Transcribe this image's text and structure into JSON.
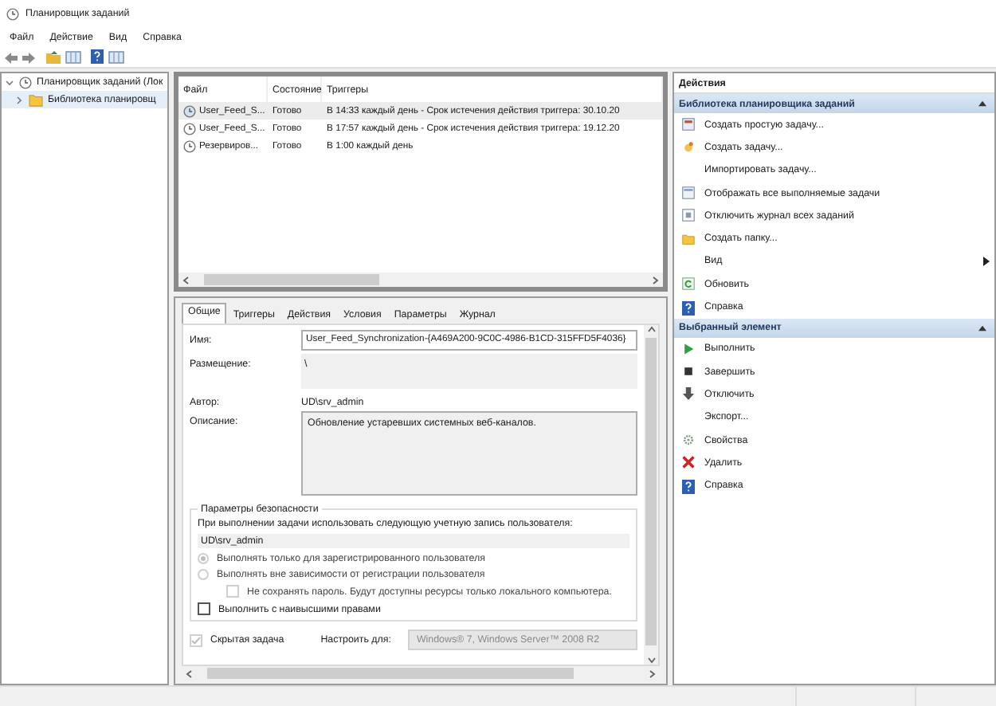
{
  "window": {
    "title": "Планировщик заданий"
  },
  "menu": [
    "Файл",
    "Действие",
    "Вид",
    "Справка"
  ],
  "tree": [
    {
      "label": "Планировщик заданий (Лок",
      "selected": false,
      "expanded": true,
      "children": [
        {
          "label": "Библиотека планировщ",
          "selected": true,
          "expanded": false
        }
      ]
    }
  ],
  "task_table": {
    "columns": [
      "Файл",
      "Состояние",
      "Триггеры"
    ],
    "rows": [
      {
        "cells": [
          "User_Feed_S...",
          "Готово",
          "В 14:33 каждый день - Срок истечения действия триггера: 30.10.20"
        ],
        "selected": true
      },
      {
        "cells": [
          "User_Feed_S...",
          "Готово",
          "В 17:57 каждый день - Срок истечения действия триггера: 19.12.20"
        ],
        "selected": false
      },
      {
        "cells": [
          "Резервиров...",
          "Готово",
          "В 1:00 каждый день"
        ],
        "selected": false
      }
    ]
  },
  "detail_tabs": [
    {
      "label": "Общие",
      "selected": true
    },
    {
      "label": "Триггеры",
      "selected": false
    },
    {
      "label": "Действия",
      "selected": false
    },
    {
      "label": "Условия",
      "selected": false
    },
    {
      "label": "Параметры",
      "selected": false
    },
    {
      "label": "Журнал",
      "selected": false
    }
  ],
  "general": {
    "name_label": "Имя:",
    "name": "User_Feed_Synchronization-{A469A200-9C0C-4986-B1CD-315FFD5F4036}",
    "location_label": "Размещение:",
    "location": "\\",
    "author_label": "Автор:",
    "author": "UD\\srv_admin",
    "description_label": "Описание:",
    "description": "Обновление устаревших системных веб-каналов."
  },
  "security": {
    "title": "Параметры безопасности",
    "account_prompt": "При выполнении задачи использовать следующую учетную запись пользователя:",
    "account": "UD\\srv_admin",
    "options": [
      {
        "kind": "radio",
        "label": "Выполнять только для зарегистрированного пользователя",
        "selected": true,
        "disabled": true,
        "nested": false
      },
      {
        "kind": "radio",
        "label": "Выполнять вне зависимости от регистрации пользователя",
        "selected": false,
        "disabled": true,
        "nested": false
      },
      {
        "kind": "checkbox",
        "label": "Не сохранять пароль. Будут доступны ресурсы только локального компьютера.",
        "checked": false,
        "disabled": true,
        "nested": true
      },
      {
        "kind": "checkbox",
        "label": "Выполнить с наивысшими правами",
        "checked": false,
        "disabled": false,
        "nested": false
      }
    ]
  },
  "hidden_task": {
    "label": "Скрытая задача",
    "checked": true,
    "disabled": true
  },
  "configure": {
    "label": "Настроить для:",
    "value": "Windows® 7, Windows Server™ 2008 R2"
  },
  "actions": {
    "title": "Действия",
    "sections": [
      {
        "title": "Библиотека планировщика заданий",
        "expanded": true,
        "items": [
          {
            "label": "Создать простую задачу...",
            "kind": "plain"
          },
          {
            "label": "Создать задачу...",
            "kind": "plain"
          },
          {
            "label": "Импортировать задачу...",
            "kind": "plain"
          },
          {
            "label": "Отображать все выполняемые задачи",
            "kind": "plain"
          },
          {
            "label": "Отключить журнал всех заданий",
            "kind": "plain"
          },
          {
            "label": "Создать папку...",
            "kind": "plain"
          },
          {
            "label": "Вид",
            "kind": "submenu"
          },
          {
            "label": "Обновить",
            "kind": "plain"
          },
          {
            "label": "Справка",
            "kind": "plain"
          }
        ]
      },
      {
        "title": "Выбранный элемент",
        "expanded": true,
        "items": [
          {
            "label": "Выполнить",
            "kind": "plain"
          },
          {
            "label": "Завершить",
            "kind": "plain"
          },
          {
            "label": "Отключить",
            "kind": "plain"
          },
          {
            "label": "Экспорт...",
            "kind": "plain"
          },
          {
            "label": "Свойства",
            "kind": "plain"
          },
          {
            "label": "Удалить",
            "kind": "plain"
          },
          {
            "label": "Справка",
            "kind": "plain"
          }
        ]
      }
    ]
  }
}
